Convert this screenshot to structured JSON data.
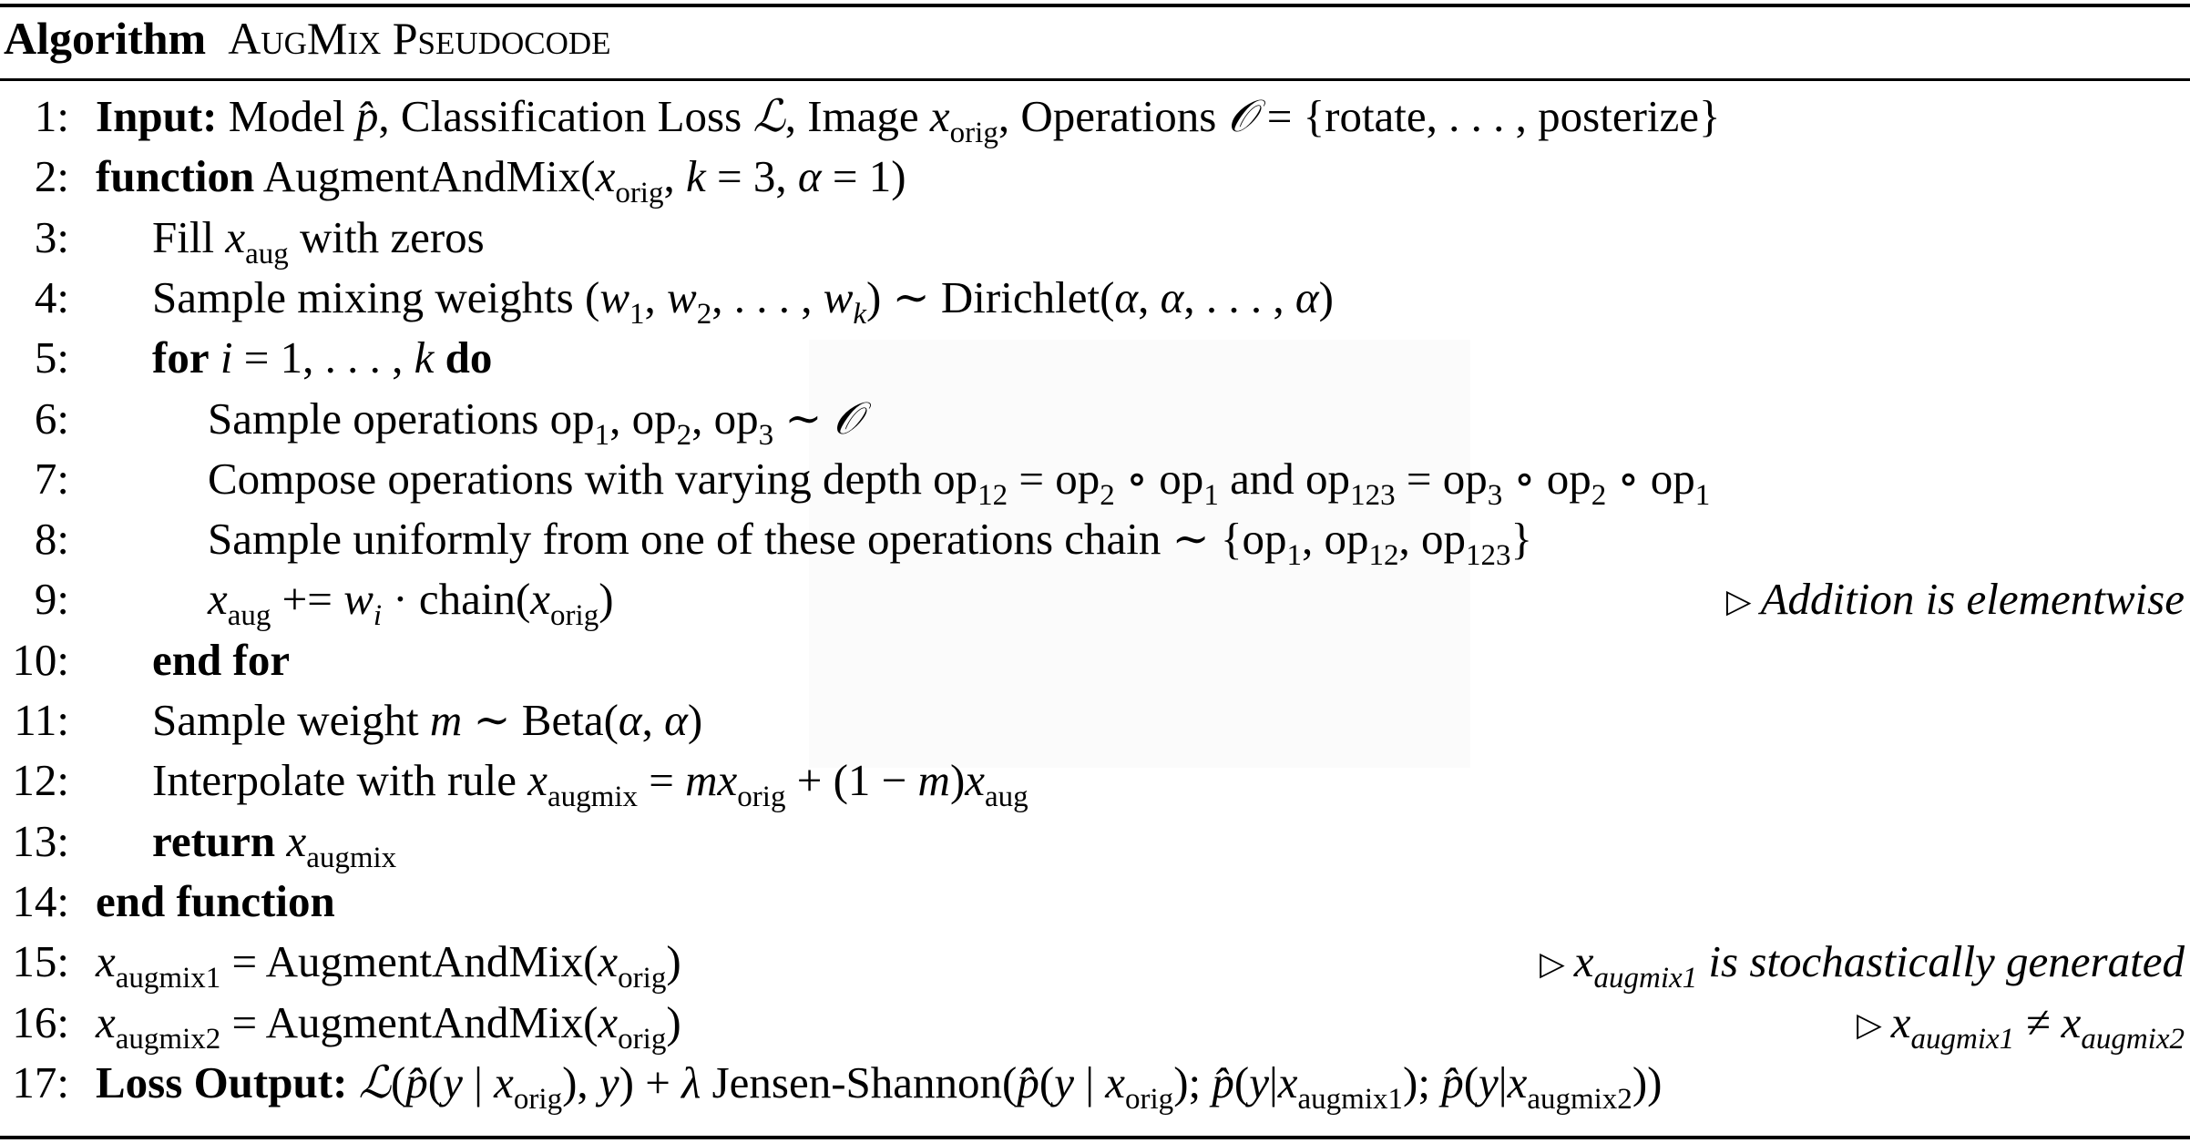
{
  "algorithm": {
    "label": "Algorithm",
    "title": "AugMix Pseudocode",
    "lines": [
      {
        "n": "1:",
        "indent": 0,
        "segs": [
          [
            "b",
            "Input:"
          ],
          [
            "t",
            " Model "
          ],
          [
            "m",
            "p̂"
          ],
          [
            "t",
            ", Classification Loss "
          ],
          [
            "cal",
            "ℒ"
          ],
          [
            "t",
            ", Image "
          ],
          [
            "m",
            "x"
          ],
          [
            "sub",
            "orig"
          ],
          [
            "t",
            ", Operations "
          ],
          [
            "cal",
            "𝒪"
          ],
          [
            "t",
            " = {rotate, . . . , posterize}"
          ]
        ]
      },
      {
        "n": "2:",
        "indent": 0,
        "segs": [
          [
            "b",
            "function"
          ],
          [
            "t",
            " AugmentAndMix("
          ],
          [
            "m",
            "x"
          ],
          [
            "sub",
            "orig"
          ],
          [
            "t",
            ",  "
          ],
          [
            "m",
            "k"
          ],
          [
            "t",
            " = 3, "
          ],
          [
            "m",
            "α"
          ],
          [
            "t",
            " = 1)"
          ]
        ]
      },
      {
        "n": "3:",
        "indent": 1,
        "segs": [
          [
            "t",
            "Fill "
          ],
          [
            "m",
            "x"
          ],
          [
            "sub",
            "aug"
          ],
          [
            "t",
            " with zeros"
          ]
        ]
      },
      {
        "n": "4:",
        "indent": 1,
        "segs": [
          [
            "t",
            "Sample mixing weights ("
          ],
          [
            "m",
            "w"
          ],
          [
            "sub",
            "1"
          ],
          [
            "t",
            ", "
          ],
          [
            "m",
            "w"
          ],
          [
            "sub",
            "2"
          ],
          [
            "t",
            ", . . . , "
          ],
          [
            "m",
            "w"
          ],
          [
            "subi",
            "k"
          ],
          [
            "t",
            ") ∼ Dirichlet("
          ],
          [
            "m",
            "α"
          ],
          [
            "t",
            ", "
          ],
          [
            "m",
            "α"
          ],
          [
            "t",
            ", . . . , "
          ],
          [
            "m",
            "α"
          ],
          [
            "t",
            ")"
          ]
        ]
      },
      {
        "n": "5:",
        "indent": 1,
        "segs": [
          [
            "b",
            "for"
          ],
          [
            "t",
            " "
          ],
          [
            "m",
            "i"
          ],
          [
            "t",
            " = 1, . . . , "
          ],
          [
            "m",
            "k"
          ],
          [
            "t",
            " "
          ],
          [
            "b",
            "do"
          ]
        ]
      },
      {
        "n": "6:",
        "indent": 2,
        "segs": [
          [
            "t",
            "Sample operations op"
          ],
          [
            "sub",
            "1"
          ],
          [
            "t",
            ", op"
          ],
          [
            "sub",
            "2"
          ],
          [
            "t",
            ", op"
          ],
          [
            "sub",
            "3"
          ],
          [
            "t",
            " ∼ "
          ],
          [
            "cal",
            "𝒪"
          ]
        ]
      },
      {
        "n": "7:",
        "indent": 2,
        "segs": [
          [
            "t",
            "Compose operations with varying depth op"
          ],
          [
            "sub",
            "12"
          ],
          [
            "t",
            " = op"
          ],
          [
            "sub",
            "2"
          ],
          [
            "t",
            " ∘ op"
          ],
          [
            "sub",
            "1"
          ],
          [
            "t",
            " and op"
          ],
          [
            "sub",
            "123"
          ],
          [
            "t",
            " = op"
          ],
          [
            "sub",
            "3"
          ],
          [
            "t",
            " ∘ op"
          ],
          [
            "sub",
            "2"
          ],
          [
            "t",
            " ∘ op"
          ],
          [
            "sub",
            "1"
          ]
        ]
      },
      {
        "n": "8:",
        "indent": 2,
        "segs": [
          [
            "t",
            "Sample uniformly from one of these operations chain ∼ {op"
          ],
          [
            "sub",
            "1"
          ],
          [
            "t",
            ", op"
          ],
          [
            "sub",
            "12"
          ],
          [
            "t",
            ", op"
          ],
          [
            "sub",
            "123"
          ],
          [
            "t",
            "}"
          ]
        ]
      },
      {
        "n": "9:",
        "indent": 2,
        "segs": [
          [
            "m",
            "x"
          ],
          [
            "sub",
            "aug"
          ],
          [
            "t",
            " += "
          ],
          [
            "m",
            "w"
          ],
          [
            "subi",
            "i"
          ],
          [
            "t",
            " · chain("
          ],
          [
            "m",
            "x"
          ],
          [
            "sub",
            "orig"
          ],
          [
            "t",
            ")"
          ]
        ],
        "comment": [
          [
            "t",
            "Addition is elementwise"
          ]
        ]
      },
      {
        "n": "10:",
        "indent": 1,
        "segs": [
          [
            "b",
            "end for"
          ]
        ]
      },
      {
        "n": "11:",
        "indent": 1,
        "segs": [
          [
            "t",
            "Sample weight "
          ],
          [
            "m",
            "m"
          ],
          [
            "t",
            " ∼ Beta("
          ],
          [
            "m",
            "α"
          ],
          [
            "t",
            ", "
          ],
          [
            "m",
            "α"
          ],
          [
            "t",
            ")"
          ]
        ]
      },
      {
        "n": "12:",
        "indent": 1,
        "segs": [
          [
            "t",
            "Interpolate with rule "
          ],
          [
            "m",
            "x"
          ],
          [
            "sub",
            "augmix"
          ],
          [
            "t",
            " = "
          ],
          [
            "m",
            "mx"
          ],
          [
            "sub",
            "orig"
          ],
          [
            "t",
            " + (1 − "
          ],
          [
            "m",
            "m"
          ],
          [
            "t",
            ")"
          ],
          [
            "m",
            "x"
          ],
          [
            "sub",
            "aug"
          ]
        ]
      },
      {
        "n": "13:",
        "indent": 1,
        "segs": [
          [
            "b",
            "return"
          ],
          [
            "t",
            " "
          ],
          [
            "m",
            "x"
          ],
          [
            "sub",
            "augmix"
          ]
        ]
      },
      {
        "n": "14:",
        "indent": 0,
        "segs": [
          [
            "b",
            "end function"
          ]
        ]
      },
      {
        "n": "15:",
        "indent": 0,
        "segs": [
          [
            "m",
            "x"
          ],
          [
            "sub",
            "augmix1"
          ],
          [
            "t",
            " = AugmentAndMix("
          ],
          [
            "m",
            "x"
          ],
          [
            "sub",
            "orig"
          ],
          [
            "t",
            ")"
          ]
        ],
        "comment": [
          [
            "t",
            "x"
          ],
          [
            "subi",
            "augmix1"
          ],
          [
            "t",
            " is stochastically generated"
          ]
        ]
      },
      {
        "n": "16:",
        "indent": 0,
        "segs": [
          [
            "m",
            "x"
          ],
          [
            "sub",
            "augmix2"
          ],
          [
            "t",
            " = AugmentAndMix("
          ],
          [
            "m",
            "x"
          ],
          [
            "sub",
            "orig"
          ],
          [
            "t",
            ")"
          ]
        ],
        "comment": [
          [
            "t",
            "x"
          ],
          [
            "subi",
            "augmix1"
          ],
          [
            "t",
            " ≠ x"
          ],
          [
            "subi",
            "augmix2"
          ]
        ]
      },
      {
        "n": "17:",
        "indent": 0,
        "segs": [
          [
            "b",
            "Loss Output:"
          ],
          [
            "t",
            " "
          ],
          [
            "cal",
            "ℒ"
          ],
          [
            "t",
            "("
          ],
          [
            "m",
            "p̂"
          ],
          [
            "t",
            "("
          ],
          [
            "m",
            "y"
          ],
          [
            "t",
            " | "
          ],
          [
            "m",
            "x"
          ],
          [
            "sub",
            "orig"
          ],
          [
            "t",
            "), "
          ],
          [
            "m",
            "y"
          ],
          [
            "t",
            ") + "
          ],
          [
            "m",
            "λ"
          ],
          [
            "t",
            " Jensen-Shannon("
          ],
          [
            "m",
            "p̂"
          ],
          [
            "t",
            "("
          ],
          [
            "m",
            "y"
          ],
          [
            "t",
            " | "
          ],
          [
            "m",
            "x"
          ],
          [
            "sub",
            "orig"
          ],
          [
            "t",
            "); "
          ],
          [
            "m",
            "p̂"
          ],
          [
            "t",
            "("
          ],
          [
            "m",
            "y"
          ],
          [
            "t",
            "|"
          ],
          [
            "m",
            "x"
          ],
          [
            "sub",
            "augmix1"
          ],
          [
            "t",
            "); "
          ],
          [
            "m",
            "p̂"
          ],
          [
            "t",
            "("
          ],
          [
            "m",
            "y"
          ],
          [
            "t",
            "|"
          ],
          [
            "m",
            "x"
          ],
          [
            "sub",
            "augmix2"
          ],
          [
            "t",
            "))"
          ]
        ]
      }
    ],
    "comment_marker": "▷"
  }
}
